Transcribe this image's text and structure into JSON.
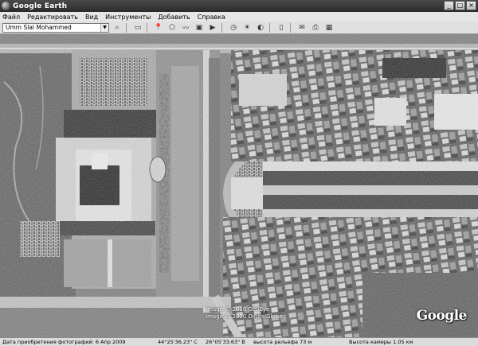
{
  "window": {
    "title": "Google Earth",
    "buttons": [
      "_",
      "□",
      "×"
    ]
  },
  "menu": [
    "Файл",
    "Редактировать",
    "Вид",
    "Инструменты",
    "Добавить",
    "Справка"
  ],
  "toolbar": {
    "search_value": "Umm Slal Mohammed",
    "buttons": [
      {
        "name": "search-button",
        "icon": "⌕"
      },
      {
        "name": "sidebar-toggle-button",
        "icon": "▭"
      },
      {
        "name": "placemark-button",
        "icon": "📍"
      },
      {
        "name": "polygon-button",
        "icon": "⬠"
      },
      {
        "name": "path-button",
        "icon": "〰"
      },
      {
        "name": "image-overlay-button",
        "icon": "▣"
      },
      {
        "name": "record-tour-button",
        "icon": "▶"
      },
      {
        "name": "historical-imagery-button",
        "icon": "◷"
      },
      {
        "name": "sunlight-button",
        "icon": "☀"
      },
      {
        "name": "planets-button",
        "icon": "◐"
      },
      {
        "name": "ruler-button",
        "icon": "▯"
      },
      {
        "name": "email-button",
        "icon": "✉"
      },
      {
        "name": "print-button",
        "icon": "⎙"
      },
      {
        "name": "maps-button",
        "icon": "▦"
      }
    ]
  },
  "map": {
    "attribution_line1": "Image © 2010 GeoEye",
    "attribution_line2": "Image © 2010 DigitalGlobe",
    "logo": "Google"
  },
  "status": {
    "imagery_date": "Дата приобретения фотографий: 6 Апр 2009",
    "lat": "44°25'36.23\" С",
    "lon": "26°05'33.63\" В",
    "elevation": "высота рельефа  73 м",
    "camera": "Высота камеры    1.05 км"
  }
}
